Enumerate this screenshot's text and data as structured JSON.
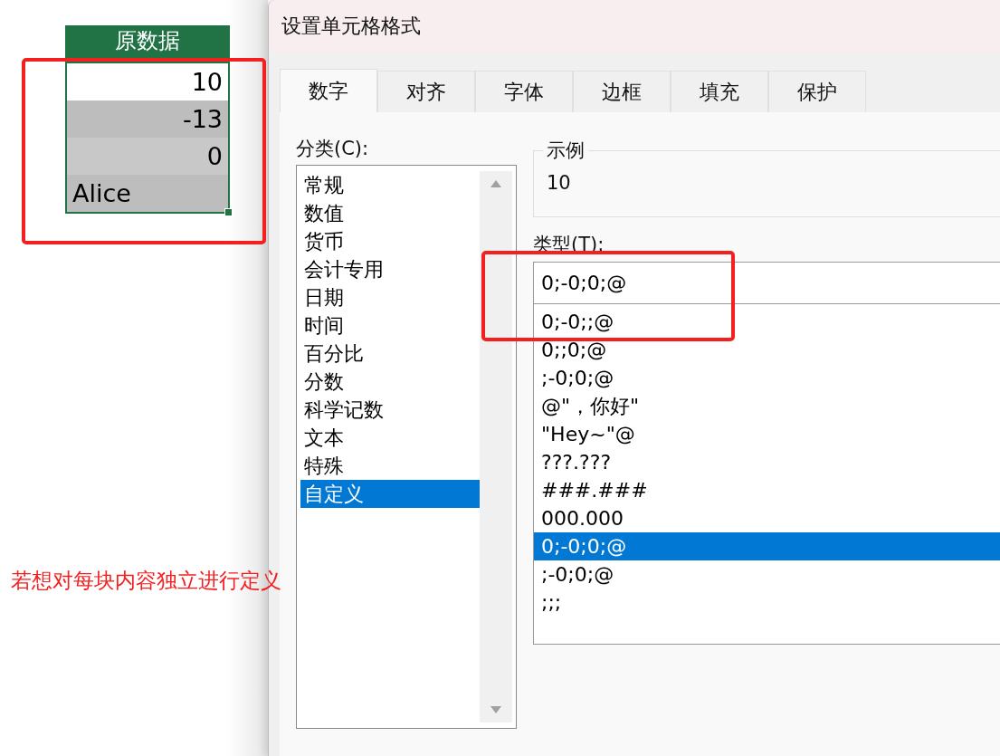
{
  "sheet": {
    "header": "原数据",
    "cells": [
      {
        "value": "10",
        "kind": "number",
        "color": "#ffffff"
      },
      {
        "value": "-13",
        "kind": "number",
        "color": "#bdbdbd"
      },
      {
        "value": "0",
        "kind": "number",
        "color": "#c8c8c8"
      },
      {
        "value": "Alice",
        "kind": "text",
        "color": "#bdbdbd"
      }
    ]
  },
  "dialog": {
    "title": "设置单元格格式",
    "tabs": [
      {
        "label": "数字",
        "selected": true
      },
      {
        "label": "对齐",
        "selected": false
      },
      {
        "label": "字体",
        "selected": false
      },
      {
        "label": "边框",
        "selected": false
      },
      {
        "label": "填充",
        "selected": false
      },
      {
        "label": "保护",
        "selected": false
      }
    ],
    "category_label": "分类(C):",
    "categories": [
      {
        "label": "常规",
        "selected": false
      },
      {
        "label": "数值",
        "selected": false
      },
      {
        "label": "货币",
        "selected": false
      },
      {
        "label": "会计专用",
        "selected": false
      },
      {
        "label": "日期",
        "selected": false
      },
      {
        "label": "时间",
        "selected": false
      },
      {
        "label": "百分比",
        "selected": false
      },
      {
        "label": "分数",
        "selected": false
      },
      {
        "label": "科学记数",
        "selected": false
      },
      {
        "label": "文本",
        "selected": false
      },
      {
        "label": "特殊",
        "selected": false
      },
      {
        "label": "自定义",
        "selected": true
      }
    ],
    "sample": {
      "label": "示例",
      "value": "10"
    },
    "type_label": "类型(T):",
    "type_value": "0;-0;0;@",
    "formats": [
      {
        "label": "0;-0;;@",
        "selected": false
      },
      {
        "label": "0;;0;@",
        "selected": false
      },
      {
        "label": ";-0;0;@",
        "selected": false
      },
      {
        "label": "@\"，你好\"",
        "selected": false
      },
      {
        "label": "\"Hey~\"@",
        "selected": false
      },
      {
        "label": "???.???",
        "selected": false
      },
      {
        "label": "###.###",
        "selected": false
      },
      {
        "label": "000.000",
        "selected": false
      },
      {
        "label": "0;-0;0;@",
        "selected": true
      },
      {
        "label": ";-0;0;@",
        "selected": false
      },
      {
        "label": ";;;",
        "selected": false
      }
    ]
  },
  "annotation": {
    "text": "若想对每块内容独立进行定义"
  }
}
